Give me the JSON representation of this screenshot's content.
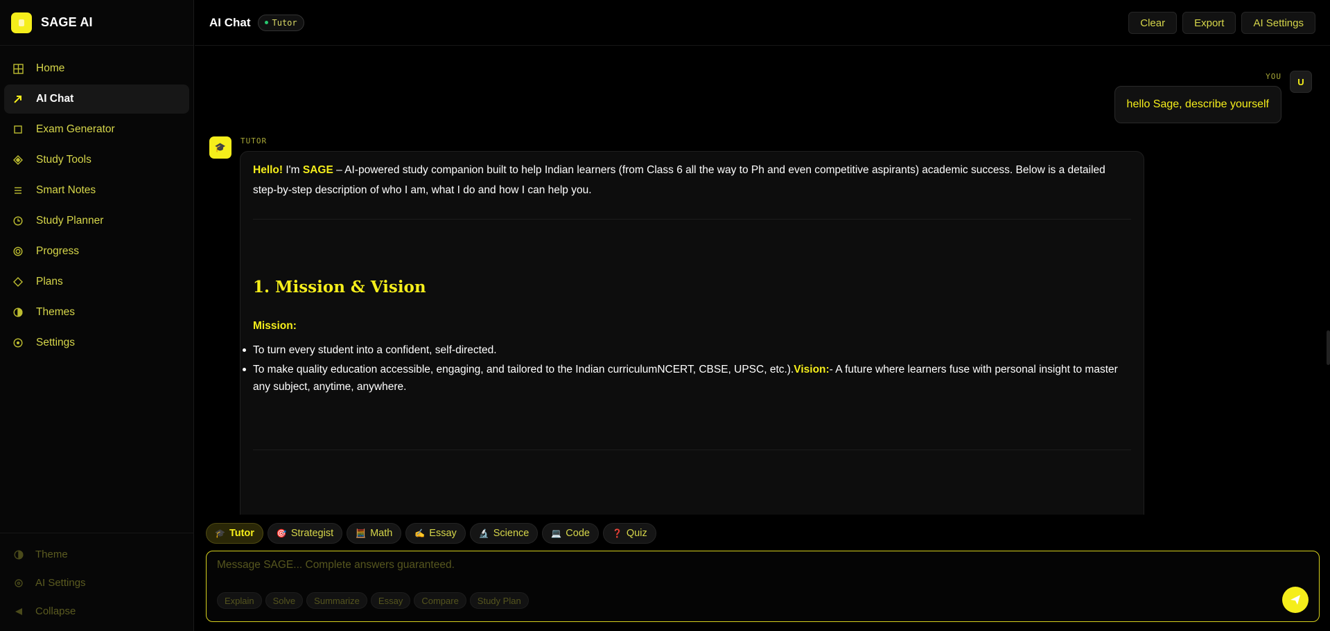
{
  "brand": {
    "name": "SAGE AI"
  },
  "sidebar": {
    "items": [
      {
        "label": "Home",
        "icon": "grid-icon"
      },
      {
        "label": "AI Chat",
        "icon": "arrow-icon"
      },
      {
        "label": "Exam Generator",
        "icon": "square-icon"
      },
      {
        "label": "Study Tools",
        "icon": "diamond-icon"
      },
      {
        "label": "Smart Notes",
        "icon": "list-icon"
      },
      {
        "label": "Study Planner",
        "icon": "clock-icon"
      },
      {
        "label": "Progress",
        "icon": "target-icon"
      },
      {
        "label": "Plans",
        "icon": "diamond-outline-icon"
      },
      {
        "label": "Themes",
        "icon": "half-circle-icon"
      },
      {
        "label": "Settings",
        "icon": "gear-icon"
      }
    ],
    "bottom": [
      {
        "label": "Theme"
      },
      {
        "label": "AI Settings"
      },
      {
        "label": "Collapse"
      }
    ]
  },
  "header": {
    "title": "AI Chat",
    "mode_badge": "Tutor",
    "actions": {
      "clear": "Clear",
      "export": "Export",
      "ai_settings": "AI Settings"
    }
  },
  "chat": {
    "user": {
      "label": "YOU",
      "avatar": "U",
      "message": "hello Sage, describe yourself"
    },
    "bot": {
      "label": "TUTOR",
      "hello": "Hello!",
      "intro_a": " I'm ",
      "sage": "SAGE",
      "intro_b": " – AI‑powered study companion built to help Indian learners (from Class 6 all the way to Ph and even competitive aspirants) academic success. Below is a detailed step‑by‑step description of who I am, what I do and how I can help you.",
      "section_title": "1. Mission & Vision",
      "mission_label": "Mission:",
      "bullet1": "To turn every student into a confident, self‑directed.",
      "bullet2_a": "To make quality education accessible, engaging, and tailored to the Indian curriculumNCERT, CBSE, UPSC, etc.).",
      "vision_label": "Vision:",
      "bullet2_b": "- A future where learners fuse with personal insight to master any subject, anytime, anywhere."
    }
  },
  "composer": {
    "modes": [
      {
        "emoji": "🎓",
        "label": "Tutor"
      },
      {
        "emoji": "🎯",
        "label": "Strategist"
      },
      {
        "emoji": "🧮",
        "label": "Math"
      },
      {
        "emoji": "✍️",
        "label": "Essay"
      },
      {
        "emoji": "🔬",
        "label": "Science"
      },
      {
        "emoji": "💻",
        "label": "Code"
      },
      {
        "emoji": "❓",
        "label": "Quiz"
      }
    ],
    "placeholder": "Message SAGE... Complete answers guaranteed.",
    "quick_actions": [
      "Explain",
      "Solve",
      "Summarize",
      "Essay",
      "Compare",
      "Study Plan"
    ]
  },
  "colors": {
    "accent": "#f5ee1b",
    "background": "#000000",
    "panel": "#0d0d0d"
  }
}
